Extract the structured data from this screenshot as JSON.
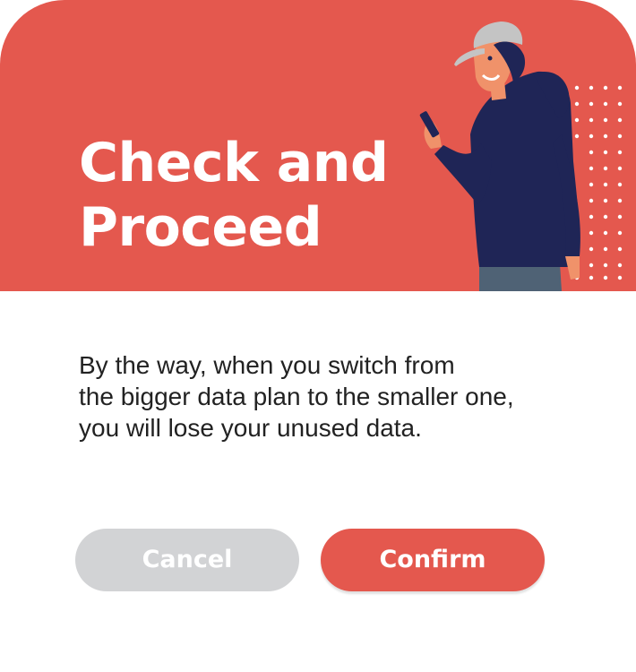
{
  "dialog": {
    "title_lines": [
      "Check and",
      "Proceed"
    ],
    "message_lines": [
      "By the way, when you switch from",
      "the bigger data plan to the smaller one,",
      "you will lose your unused data."
    ],
    "cancel_label": "Cancel",
    "confirm_label": "Confirm"
  },
  "colors": {
    "accent": "#e4584e",
    "cancel_button": "#d2d3d5",
    "text": "#222222",
    "hoodie": "#1f2556",
    "cap": "#c4c4c4",
    "skin": "#f0926a",
    "jeans": "#4f6275"
  },
  "icons": {
    "illustration": "person-with-phone-illustration",
    "decoration": "dot-grid-decoration"
  }
}
